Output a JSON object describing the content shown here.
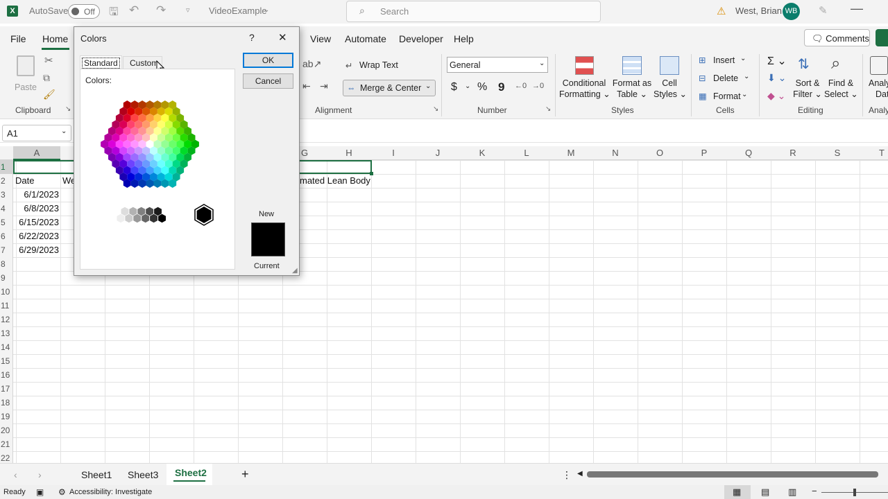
{
  "titlebar": {
    "autosave_label": "AutoSave",
    "autosave_state": "Off",
    "filename": "VideoExample",
    "search_placeholder": "Search",
    "user": "West, Brian",
    "user_initials": "WB"
  },
  "tabs": [
    "File",
    "Home",
    "View",
    "Automate",
    "Developer",
    "Help"
  ],
  "comments_label": "Comments",
  "ribbon": {
    "paste": "Paste",
    "wrap_text": "Wrap Text",
    "merge_center": "Merge & Center",
    "number_format": "General",
    "conditional": [
      "Conditional",
      "Formatting"
    ],
    "format_table": [
      "Format as",
      "Table"
    ],
    "cell_styles": [
      "Cell",
      "Styles"
    ],
    "insert": "Insert",
    "delete": "Delete",
    "format": "Format",
    "sort_filter": [
      "Sort &",
      "Filter"
    ],
    "find_select": [
      "Find &",
      "Select"
    ],
    "analyze": [
      "Analy",
      "Dat"
    ],
    "groups": {
      "clipboard": "Clipboard",
      "alignment": "Alignment",
      "number": "Number",
      "styles": "Styles",
      "cells": "Cells",
      "editing": "Editing",
      "analysis": "Analy"
    }
  },
  "namebox": "A1",
  "columns": [
    "A",
    "G",
    "H",
    "I",
    "J",
    "K",
    "L",
    "M",
    "N",
    "O",
    "P",
    "Q",
    "R",
    "S",
    "T"
  ],
  "rows": [
    "1",
    "2",
    "3",
    "4",
    "5",
    "6",
    "7",
    "8",
    "9",
    "10",
    "11",
    "12",
    "13",
    "14",
    "15",
    "16",
    "17",
    "18",
    "19",
    "20",
    "21",
    "22"
  ],
  "cells": {
    "a2": "Date",
    "b2_partial": "We",
    "h2_partial": "mated Lean Body",
    "dates": [
      "6/1/2023",
      "6/8/2023",
      "6/15/2023",
      "6/22/2023",
      "6/29/2023"
    ]
  },
  "sheets": [
    "Sheet1",
    "Sheet3",
    "Sheet2"
  ],
  "active_sheet": "Sheet2",
  "status": {
    "ready": "Ready",
    "accessibility": "Accessibility: Investigate"
  },
  "dialog": {
    "title": "Colors",
    "help": "?",
    "close": "✕",
    "tab_standard": "Standard",
    "tab_custom": "Custom",
    "colors_label": "Colors:",
    "ok": "OK",
    "cancel": "Cancel",
    "new_label": "New",
    "current_label": "Current",
    "new_color": "#000000"
  }
}
